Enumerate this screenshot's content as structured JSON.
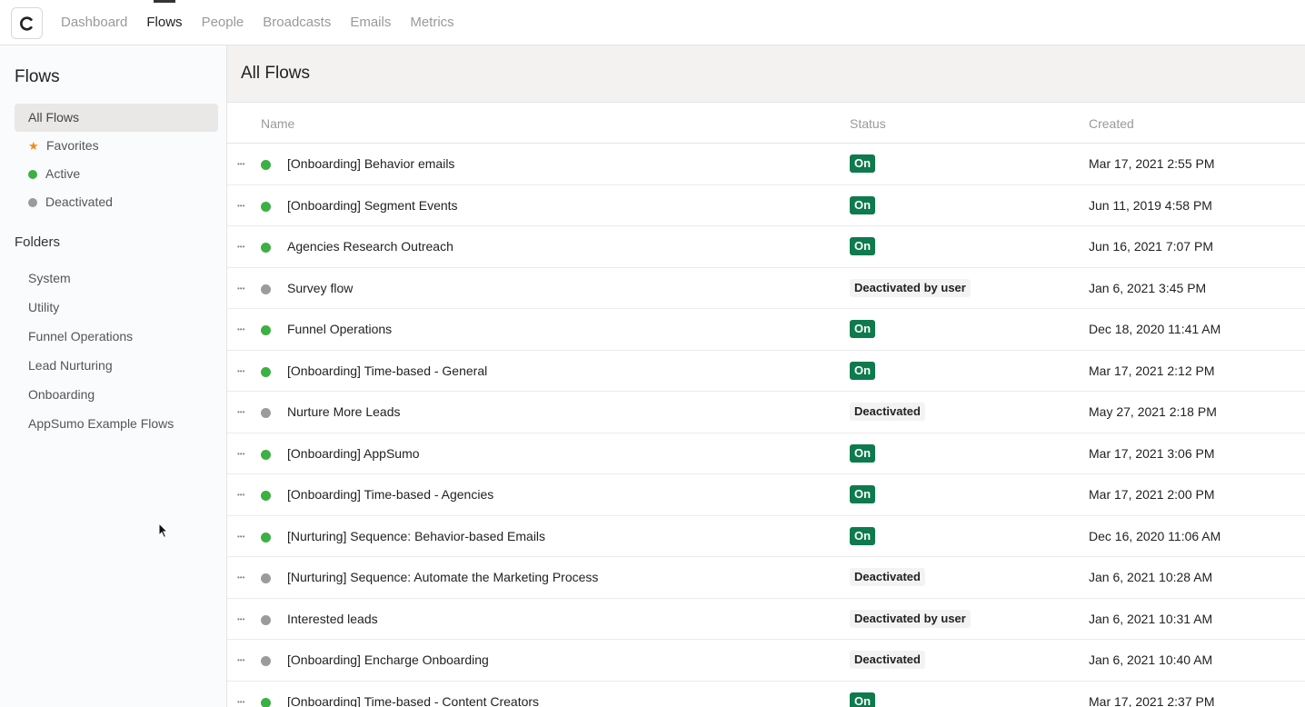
{
  "nav": {
    "items": [
      {
        "label": "Dashboard",
        "active": false
      },
      {
        "label": "Flows",
        "active": true
      },
      {
        "label": "People",
        "active": false
      },
      {
        "label": "Broadcasts",
        "active": false
      },
      {
        "label": "Emails",
        "active": false
      },
      {
        "label": "Metrics",
        "active": false
      }
    ]
  },
  "sidebar": {
    "title": "Flows",
    "filters": [
      {
        "label": "All Flows",
        "icon": "none",
        "active": true
      },
      {
        "label": "Favorites",
        "icon": "star-icon",
        "active": false
      },
      {
        "label": "Active",
        "icon": "green-dot-icon",
        "active": false
      },
      {
        "label": "Deactivated",
        "icon": "grey-dot-icon",
        "active": false
      }
    ],
    "folders_title": "Folders",
    "folders": [
      "System",
      "Utility",
      "Funnel Operations",
      "Lead Nurturing",
      "Onboarding",
      "AppSumo Example Flows"
    ]
  },
  "main": {
    "title": "All Flows",
    "columns": {
      "name": "Name",
      "status": "Status",
      "created": "Created"
    },
    "rows": [
      {
        "name": "[Onboarding] Behavior emails",
        "active": true,
        "status": "On",
        "created": "Mar 17, 2021 2:55 PM"
      },
      {
        "name": "[Onboarding] Segment Events",
        "active": true,
        "status": "On",
        "created": "Jun 11, 2019 4:58 PM"
      },
      {
        "name": "Agencies Research Outreach",
        "active": true,
        "status": "On",
        "created": "Jun 16, 2021 7:07 PM"
      },
      {
        "name": "Survey flow",
        "active": false,
        "status": "Deactivated by user",
        "created": "Jan 6, 2021 3:45 PM"
      },
      {
        "name": "Funnel Operations",
        "active": true,
        "status": "On",
        "created": "Dec 18, 2020 11:41 AM"
      },
      {
        "name": "[Onboarding] Time-based - General",
        "active": true,
        "status": "On",
        "created": "Mar 17, 2021 2:12 PM"
      },
      {
        "name": "Nurture More Leads",
        "active": false,
        "status": "Deactivated",
        "created": "May 27, 2021 2:18 PM"
      },
      {
        "name": "[Onboarding] AppSumo",
        "active": true,
        "status": "On",
        "created": "Mar 17, 2021 3:06 PM"
      },
      {
        "name": "[Onboarding] Time-based - Agencies",
        "active": true,
        "status": "On",
        "created": "Mar 17, 2021 2:00 PM"
      },
      {
        "name": "[Nurturing] Sequence: Behavior-based Emails",
        "active": true,
        "status": "On",
        "created": "Dec 16, 2020 11:06 AM"
      },
      {
        "name": "[Nurturing] Sequence: Automate the Marketing Process",
        "active": false,
        "status": "Deactivated",
        "created": "Jan 6, 2021 10:28 AM"
      },
      {
        "name": "Interested leads",
        "active": false,
        "status": "Deactivated by user",
        "created": "Jan 6, 2021 10:31 AM"
      },
      {
        "name": "[Onboarding] Encharge Onboarding",
        "active": false,
        "status": "Deactivated",
        "created": "Jan 6, 2021 10:40 AM"
      },
      {
        "name": "[Onboarding] Time-based - Content Creators",
        "active": true,
        "status": "On",
        "created": "Mar 17, 2021 2:37 PM"
      }
    ]
  },
  "colors": {
    "active_dot": "#3cb043",
    "inactive_dot": "#9b9b9b",
    "on_badge": "#0e7a4d",
    "favorite_star": "#f08c1a"
  }
}
